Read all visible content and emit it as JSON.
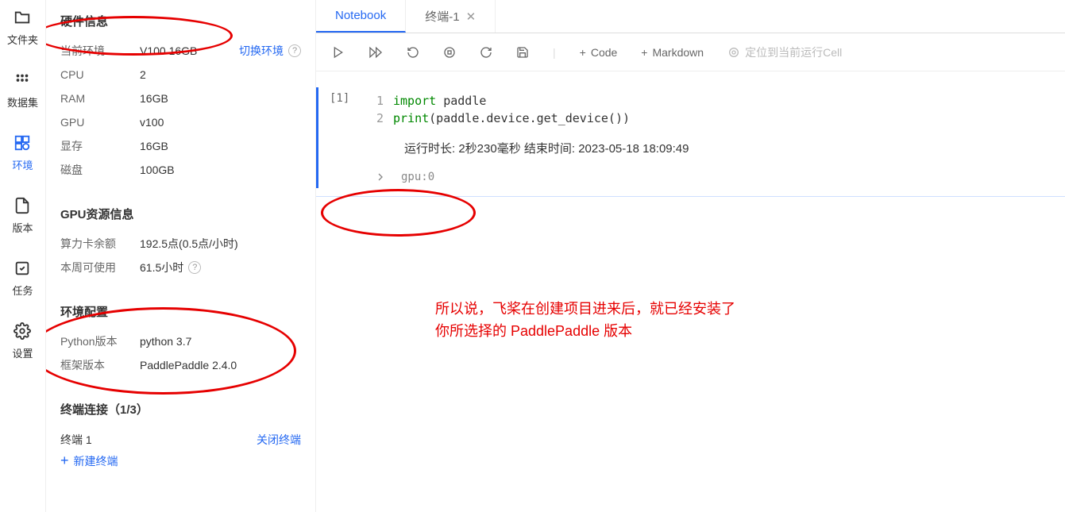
{
  "sidebar": {
    "items": [
      {
        "label": "文件夹"
      },
      {
        "label": "数据集"
      },
      {
        "label": "环境"
      },
      {
        "label": "版本"
      },
      {
        "label": "任务"
      },
      {
        "label": "设置"
      }
    ]
  },
  "hardware": {
    "title": "硬件信息",
    "env_label": "当前环境",
    "env_value": "V100 16GB",
    "switch": "切换环境",
    "cpu_label": "CPU",
    "cpu_value": "2",
    "ram_label": "RAM",
    "ram_value": "16GB",
    "gpu_label": "GPU",
    "gpu_value": "v100",
    "vram_label": "显存",
    "vram_value": "16GB",
    "disk_label": "磁盘",
    "disk_value": "100GB"
  },
  "gpu_res": {
    "title": "GPU资源信息",
    "card_label": "算力卡余额",
    "card_value": "192.5点(0.5点/小时)",
    "week_label": "本周可使用",
    "week_value": "61.5小时"
  },
  "env_config": {
    "title": "环境配置",
    "py_label": "Python版本",
    "py_value": "python 3.7",
    "fw_label": "框架版本",
    "fw_value": "PaddlePaddle 2.4.0"
  },
  "terminal": {
    "title": "终端连接（1/3）",
    "name": "终端 1",
    "close": "关闭终端",
    "new": "新建终端"
  },
  "tabs": {
    "notebook": "Notebook",
    "terminal": "终端-1"
  },
  "toolbar": {
    "code": "Code",
    "markdown": "Markdown",
    "locate": "定位到当前运行Cell"
  },
  "cell": {
    "prompt": "[1]",
    "ln1": "1",
    "ln2": "2",
    "code1_kw": "import",
    "code1_id": " paddle",
    "code2_fn": "print",
    "code2_rest": "(paddle.device.get_device())",
    "runinfo": "运行时长: 2秒230毫秒    结束时间: 2023-05-18 18:09:49",
    "output": "gpu:0"
  },
  "annotation": "所以说，飞桨在创建项目进来后，就已经安装了\n你所选择的 PaddlePaddle 版本"
}
